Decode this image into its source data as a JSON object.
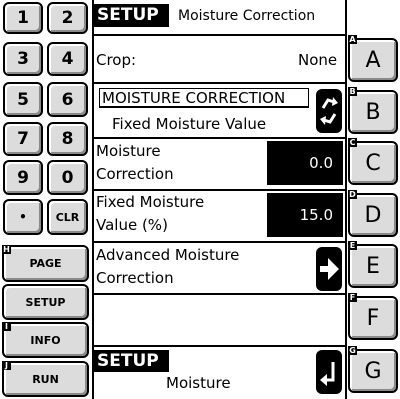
{
  "keypad": {
    "keys": [
      "1",
      "2",
      "3",
      "4",
      "5",
      "6",
      "7",
      "8",
      "9",
      "0",
      "•",
      "CLR"
    ]
  },
  "left_buttons": {
    "page": "PAGE",
    "setup": "SETUP",
    "info": "INFO",
    "run": "RUN",
    "page_tag": "H",
    "info_tag": "I",
    "run_tag": "J"
  },
  "header": {
    "badge": "SETUP",
    "title": "Moisture Correction"
  },
  "rows": {
    "crop_label": "Crop:",
    "crop_value": "None",
    "mode_title": "MOISTURE CORRECTION",
    "mode_value": "Fixed Moisture Value",
    "mc_label_1": "Moisture",
    "mc_label_2": "Correction",
    "mc_value": "0.0",
    "fixed_label_1": "Fixed Moisture",
    "fixed_label_2": "Value (%)",
    "fixed_value": "15.0",
    "adv_label_1": "Advanced Moisture",
    "adv_label_2": "Correction"
  },
  "footer": {
    "badge": "SETUP",
    "subtitle": "Moisture"
  },
  "softkeys": [
    {
      "tag": "A",
      "label": "A"
    },
    {
      "tag": "B",
      "label": "B"
    },
    {
      "tag": "C",
      "label": "C"
    },
    {
      "tag": "D",
      "label": "D"
    },
    {
      "tag": "E",
      "label": "E"
    },
    {
      "tag": "F",
      "label": "F"
    },
    {
      "tag": "G",
      "label": "G"
    }
  ]
}
